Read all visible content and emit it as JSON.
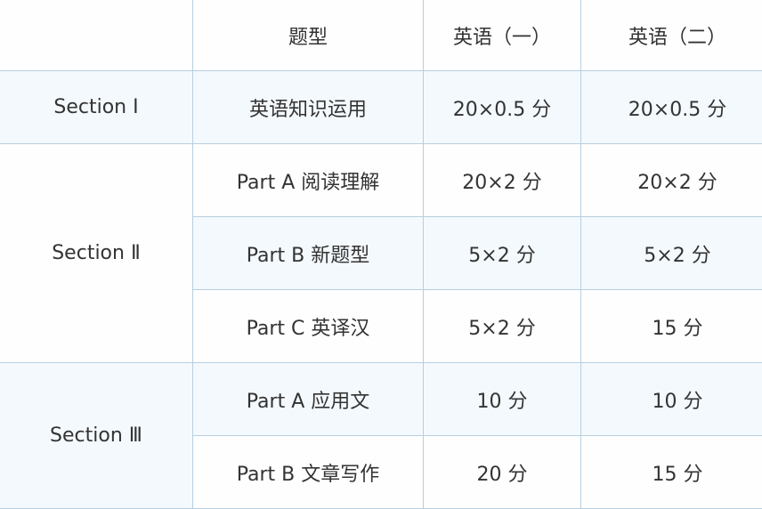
{
  "table": {
    "headers": [
      "",
      "题型",
      "英语（一）",
      "英语（二）"
    ],
    "sections": [
      {
        "label": "Section Ⅰ",
        "rows": [
          {
            "type": "英语知识运用",
            "english1": "20×0.5 分",
            "english2": "20×0.5 分"
          }
        ]
      },
      {
        "label": "Section Ⅱ",
        "rows": [
          {
            "type": "Part  A 阅读理解",
            "english1": "20×2 分",
            "english2": "20×2 分"
          },
          {
            "type": "Part  B 新题型",
            "english1": "5×2 分",
            "english2": "5×2 分"
          },
          {
            "type": "Part  C 英译汉",
            "english1": "5×2 分",
            "english2": "15 分"
          }
        ]
      },
      {
        "label": "Section Ⅲ",
        "rows": [
          {
            "type": "Part  A 应用文",
            "english1": "10 分",
            "english2": "10 分"
          },
          {
            "type": "Part  B 文章写作",
            "english1": "20 分",
            "english2": "15 分"
          }
        ]
      }
    ]
  },
  "colors": {
    "border": "#b7cfe0",
    "alt_row": "#f4f9fd",
    "text": "#333333"
  }
}
